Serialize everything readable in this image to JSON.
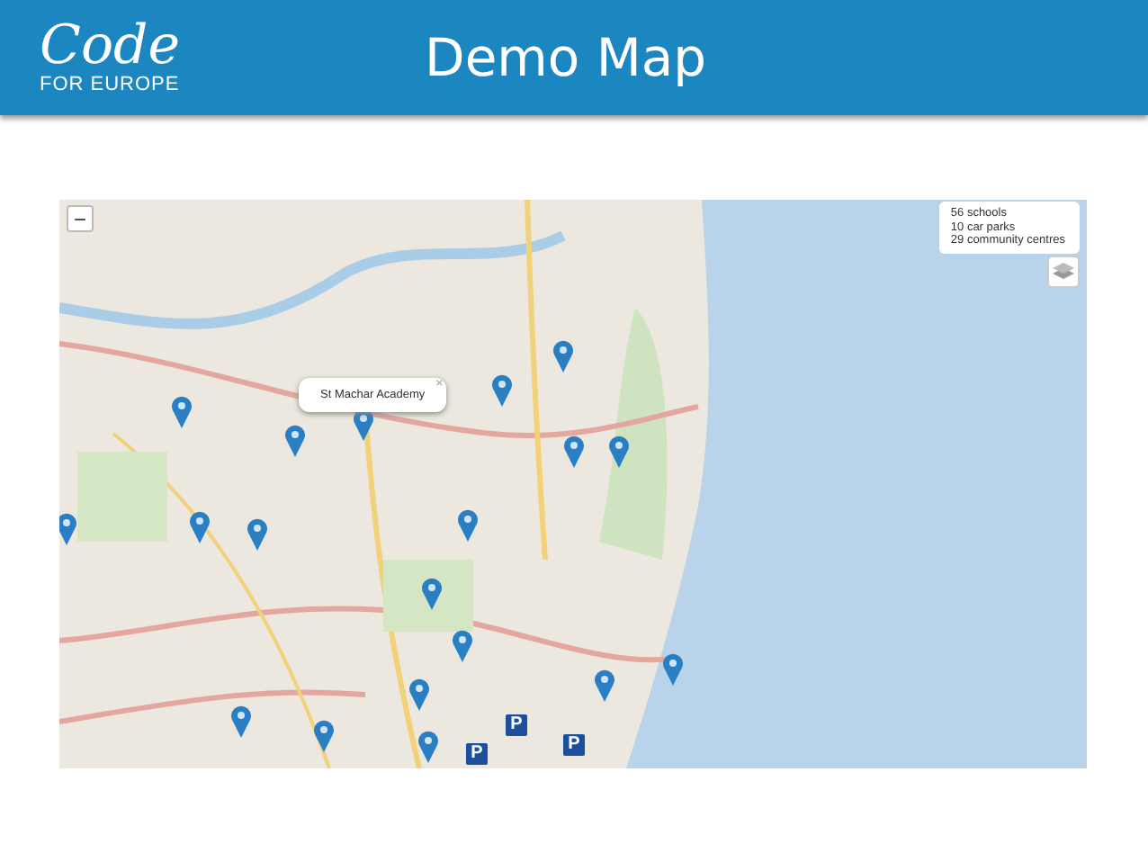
{
  "header": {
    "logo": {
      "title": "Code",
      "subtitle": "FOR EUROPE"
    },
    "title": "Demo Map"
  },
  "map": {
    "zoom_out": "−",
    "popup": {
      "text": "St Machar Academy",
      "close": "×"
    },
    "legend": [
      "56 schools",
      "10 car parks",
      "29 community centres"
    ],
    "car_park_markers": [
      "P",
      "P",
      "P"
    ]
  }
}
